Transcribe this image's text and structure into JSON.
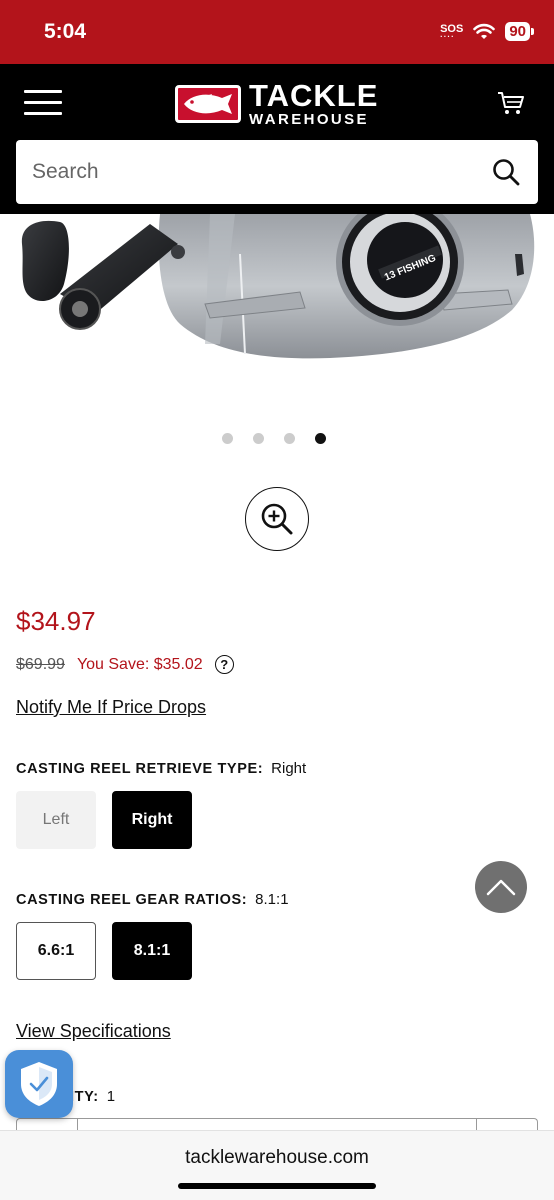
{
  "status_bar": {
    "time": "5:04",
    "sos": "SOS",
    "battery": "90",
    "background_color": "#b3141b"
  },
  "header": {
    "logo_line1": "TACKLE",
    "logo_line2": "WAREHOUSE",
    "menu_icon": "hamburger-menu-icon",
    "cart_icon": "cart-icon"
  },
  "search": {
    "placeholder": "Search",
    "value": ""
  },
  "product": {
    "image_text": "13 FISHING",
    "carousel": {
      "total": 4,
      "active_index": 4
    },
    "price": "$34.97",
    "old_price": "$69.99",
    "you_save": "You Save: $35.02",
    "help_icon_glyph": "?",
    "notify_link": "Notify Me If Price Drops",
    "price_color": "#b3141b"
  },
  "options": {
    "retrieve": {
      "label": "CASTING REEL RETRIEVE TYPE:",
      "value": "Right",
      "choices": [
        "Left",
        "Right"
      ]
    },
    "gear": {
      "label": "CASTING REEL GEAR RATIOS:",
      "value": "8.1:1",
      "choices": [
        "6.6:1",
        "8.1:1"
      ]
    }
  },
  "specs_link": "View Specifications",
  "quantity": {
    "label_visible": "ITY:",
    "value": "1"
  },
  "browser": {
    "url": "tacklewarehouse.com"
  }
}
